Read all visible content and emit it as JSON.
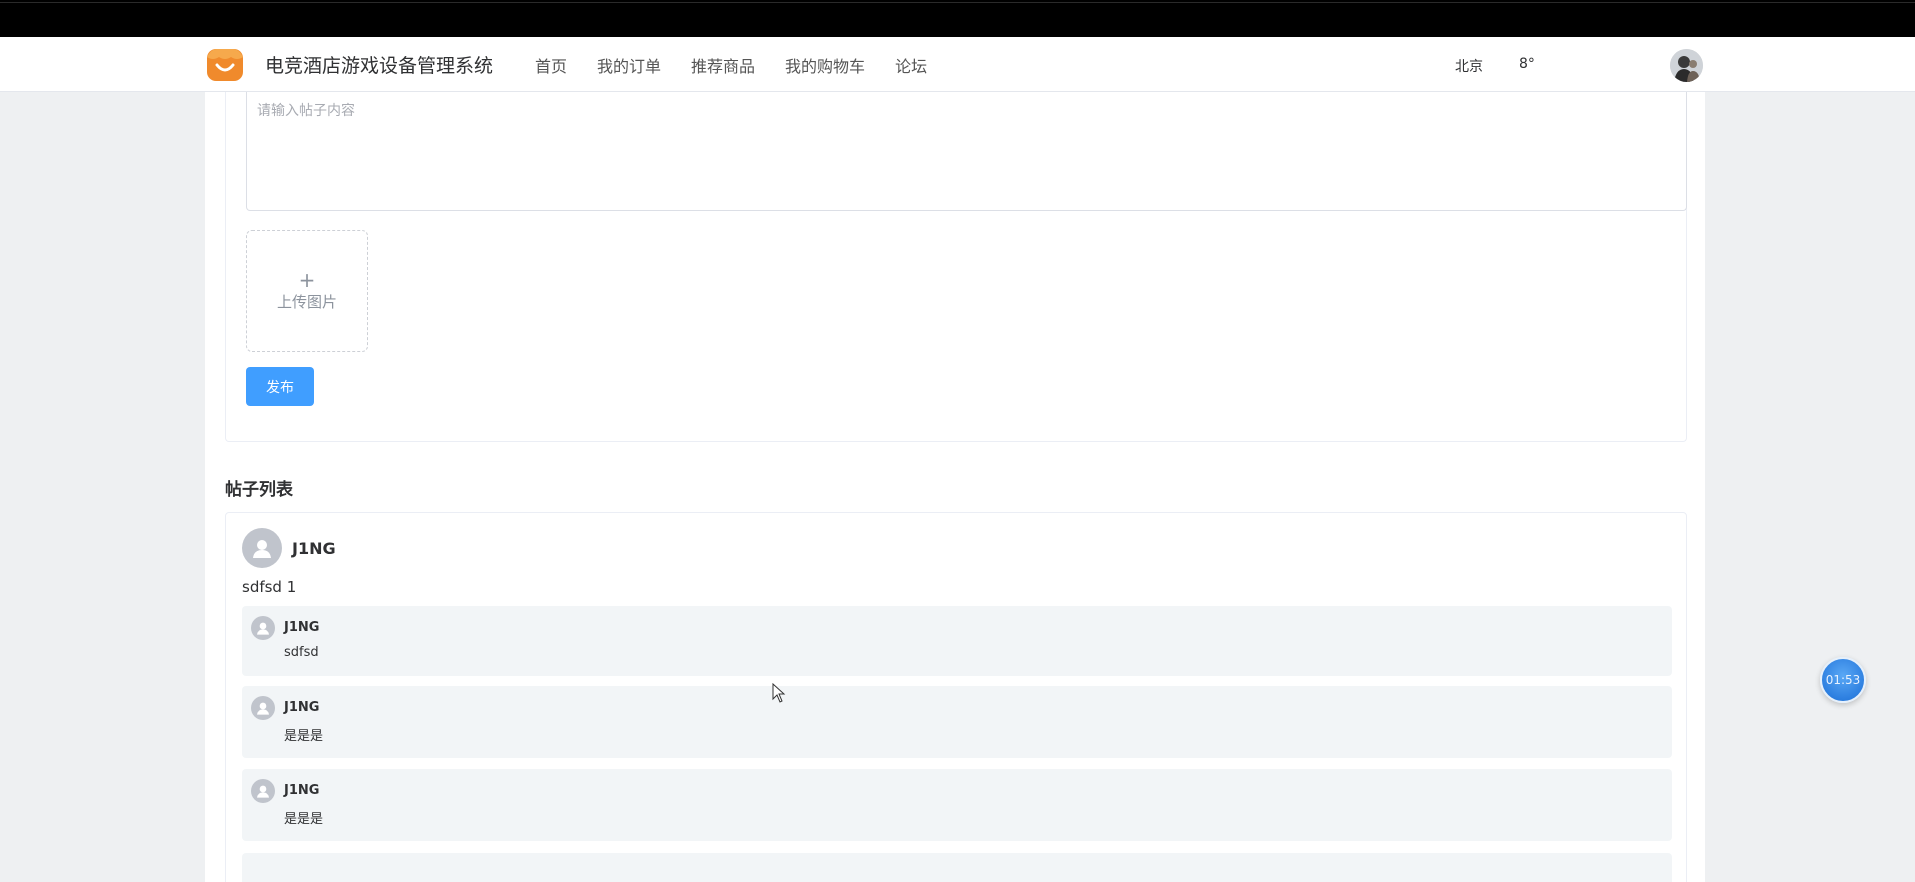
{
  "header": {
    "site_title": "电竞酒店游戏设备管理系统",
    "nav": [
      "首页",
      "我的订单",
      "推荐商品",
      "我的购物车",
      "论坛"
    ],
    "weather_city": "北京",
    "weather_temp": "8°"
  },
  "post_form": {
    "content_placeholder": "请输入帖子内容",
    "upload_plus": "+",
    "upload_label": "上传图片",
    "publish_label": "发布"
  },
  "post_list": {
    "title": "帖子列表",
    "posts": [
      {
        "author": "J1NG",
        "content": "sdfsd 1",
        "comments": [
          {
            "author": "J1NG",
            "text": "sdfsd"
          },
          {
            "author": "J1NG",
            "text": "是是是"
          },
          {
            "author": "J1NG",
            "text": "是是是"
          }
        ]
      }
    ]
  },
  "timer": {
    "value": "01:53"
  },
  "colors": {
    "primary": "#409eff",
    "logo": "#f08a2c",
    "comment_bg": "#f2f5f7"
  }
}
